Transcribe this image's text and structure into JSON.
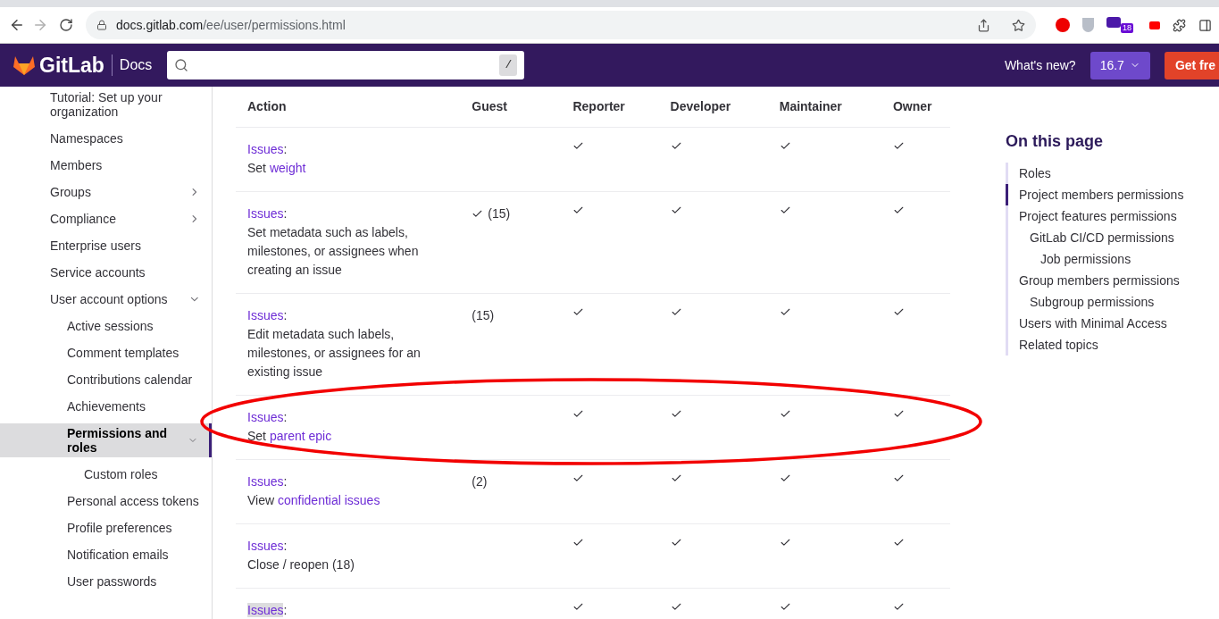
{
  "browser": {
    "url_host": "docs.gitlab.com",
    "url_path": "/ee/user/permissions.html",
    "forward_disabled": true,
    "extension_badge": "18"
  },
  "header": {
    "logo": "GitLab",
    "section": "Docs",
    "search_shortcut": "/",
    "whats_new": "What's new?",
    "version": "16.7",
    "cta": "Get fre"
  },
  "sidebar": {
    "items": [
      {
        "label": "Tutorial: Set up your organization",
        "selected": false
      },
      {
        "label": "Namespaces",
        "selected": false
      },
      {
        "label": "Members",
        "selected": false
      },
      {
        "label": "Groups",
        "selected": false,
        "expanded": false
      },
      {
        "label": "Compliance",
        "selected": false,
        "expanded": false
      },
      {
        "label": "Enterprise users",
        "selected": false
      },
      {
        "label": "Service accounts",
        "selected": false
      },
      {
        "label": "User account options",
        "selected": false,
        "expanded": true,
        "children": [
          {
            "label": "Active sessions",
            "selected": false
          },
          {
            "label": "Comment templates",
            "selected": false
          },
          {
            "label": "Contributions calendar",
            "selected": false
          },
          {
            "label": "Achievements",
            "selected": false
          },
          {
            "label": "Permissions and roles",
            "selected": true,
            "expanded": true,
            "children": [
              {
                "label": "Custom roles",
                "selected": false
              }
            ]
          },
          {
            "label": "Personal access tokens",
            "selected": false
          },
          {
            "label": "Profile preferences",
            "selected": false
          },
          {
            "label": "Notification emails",
            "selected": false
          },
          {
            "label": "User passwords",
            "selected": false
          }
        ]
      }
    ]
  },
  "table": {
    "separator": ":",
    "columns": [
      "Action",
      "Guest",
      "Reporter",
      "Developer",
      "Maintainer",
      "Owner"
    ],
    "rows": [
      {
        "category": "Issues",
        "highlighted": false,
        "action": [
          {
            "text": "Set ",
            "link": false
          },
          {
            "text": "weight",
            "link": true
          }
        ],
        "cells": [
          {
            "check": false
          },
          {
            "check": true
          },
          {
            "check": true
          },
          {
            "check": true
          },
          {
            "check": true
          }
        ]
      },
      {
        "category": "Issues",
        "highlighted": false,
        "action": [
          {
            "text": "Set metadata such as labels, milestones, or assignees when creating an issue",
            "link": false
          }
        ],
        "cells": [
          {
            "check": true,
            "note": "(15)"
          },
          {
            "check": true
          },
          {
            "check": true
          },
          {
            "check": true
          },
          {
            "check": true
          }
        ]
      },
      {
        "category": "Issues",
        "highlighted": false,
        "action": [
          {
            "text": "Edit metadata such labels, milestones, or assignees for an existing issue",
            "link": false
          }
        ],
        "cells": [
          {
            "check": false,
            "note": "(15)"
          },
          {
            "check": true
          },
          {
            "check": true
          },
          {
            "check": true
          },
          {
            "check": true
          }
        ]
      },
      {
        "category": "Issues",
        "highlighted": false,
        "action": [
          {
            "text": "Set ",
            "link": false
          },
          {
            "text": "parent epic",
            "link": true
          }
        ],
        "cells": [
          {
            "check": false
          },
          {
            "check": true
          },
          {
            "check": true
          },
          {
            "check": true
          },
          {
            "check": true
          }
        ]
      },
      {
        "category": "Issues",
        "highlighted": false,
        "action": [
          {
            "text": "View ",
            "link": false
          },
          {
            "text": "confidential issues",
            "link": true
          }
        ],
        "cells": [
          {
            "check": false,
            "note": "(2)"
          },
          {
            "check": true
          },
          {
            "check": true
          },
          {
            "check": true
          },
          {
            "check": true
          }
        ]
      },
      {
        "category": "Issues",
        "highlighted": false,
        "action": [
          {
            "text": "Close / reopen (18)",
            "link": false
          }
        ],
        "cells": [
          {
            "check": false
          },
          {
            "check": true
          },
          {
            "check": true
          },
          {
            "check": true
          },
          {
            "check": true
          }
        ]
      },
      {
        "category": "Issues",
        "highlighted": true,
        "action": [],
        "cells": [
          {
            "check": false
          },
          {
            "check": true
          },
          {
            "check": true
          },
          {
            "check": true
          },
          {
            "check": true
          }
        ]
      }
    ]
  },
  "toc": {
    "title": "On this page",
    "items": [
      {
        "label": "Roles",
        "selected": false
      },
      {
        "label": "Project members permissions",
        "selected": true
      },
      {
        "label": "Project features permissions",
        "selected": false,
        "children": [
          {
            "label": "GitLab CI/CD permissions",
            "selected": false,
            "children": [
              {
                "label": "Job permissions",
                "selected": false
              }
            ]
          }
        ]
      },
      {
        "label": "Group members permissions",
        "selected": false,
        "children": [
          {
            "label": "Subgroup permissions",
            "selected": false
          }
        ]
      },
      {
        "label": "Users with Minimal Access",
        "selected": false
      },
      {
        "label": "Related topics",
        "selected": false
      }
    ]
  }
}
